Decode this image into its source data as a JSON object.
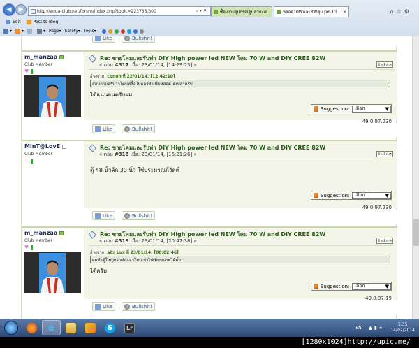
{
  "browser": {
    "address_url": "http://aqua-club.net/forum/index.php?topic=223736.300",
    "tabs": [
      {
        "label": "ซื้อ-ขายอุปกรณ์ตู้ปลาทะเล"
      },
      {
        "label": "หลอด10Wและ3Wคุ่ม pm DIY ..."
      }
    ],
    "toolbar": {
      "edit": "Edit",
      "post_to_blog": "Post to Blog"
    },
    "command_bar": {
      "page": "Page",
      "safety": "Safety",
      "tools": "Tools"
    }
  },
  "common": {
    "like_label": "Like",
    "bullshit_label": "Bullshit!",
    "suggestion_label": "Suggestion:",
    "suggestion_value": "เลือก",
    "quote_label": "อ้างอิง"
  },
  "posts": [
    {
      "username": "m_manzaa",
      "member_title": "Club Member",
      "title": "Re: ขายโคมและรับทำ DIY High power led NEW โคม 70 W and DIY CREE 82W",
      "post_number": "#317",
      "date": "23/01/14, [14:29:23]",
      "quote_from": "conon",
      "quote_date": "22/01/14, [12:42:10]",
      "quote_text": "สอบถามครับว่าโคมที่ซื้อไปแล้วทำเพิ่มหลอดได้เปล่าครับ",
      "message": "ได้แน่นอนครับผม",
      "ip": "49.0.97.230"
    },
    {
      "username": "MinT@LovE",
      "member_title": "Club Member",
      "title": "Re: ขายโคมและรับทำ DIY High power led NEW โคม 70 W and DIY CREE 82W",
      "post_number": "#318",
      "date": "23/01/14, [16:21:26]",
      "message": "ตู้ 48 นิ้วลึก 30 นิ้ว ใช้ประมาณกี่วัตต์",
      "ip": "49.0.97.230"
    },
    {
      "username": "m_manzaa",
      "member_title": "Club Member",
      "title": "Re: ขายโคมและรับทำ DIY High power led NEW โคม 70 W and DIY CREE 82W",
      "post_number": "#319",
      "date": "23/01/14, [20:47:38]",
      "quote_from": "aCr Lux",
      "quote_date": "23/01/14, [08:02:46]",
      "quote_text": "ผมทำตู้ใหญ่กว่าเดิมเอาโคมเก่าไปเพิ่มขนาดได้มั้ย",
      "message": "ได้ครับ",
      "ip": "49.0.97.19"
    }
  ],
  "labels": {
    "reply_prefix": "« ตอบ",
    "when": "เมื่อ:",
    "suffix": "»",
    "quote_from_prefix": "อ้างจาก:",
    "quote_at": "ที่"
  },
  "taskbar": {
    "apps": [
      "firefox",
      "internet-explorer",
      "file-explorer",
      "paint",
      "skype",
      "lightroom"
    ],
    "language": "EN",
    "time": "5:35",
    "date": "14/02/2014"
  },
  "watermark": "[1280x1024]http://upic.me/"
}
